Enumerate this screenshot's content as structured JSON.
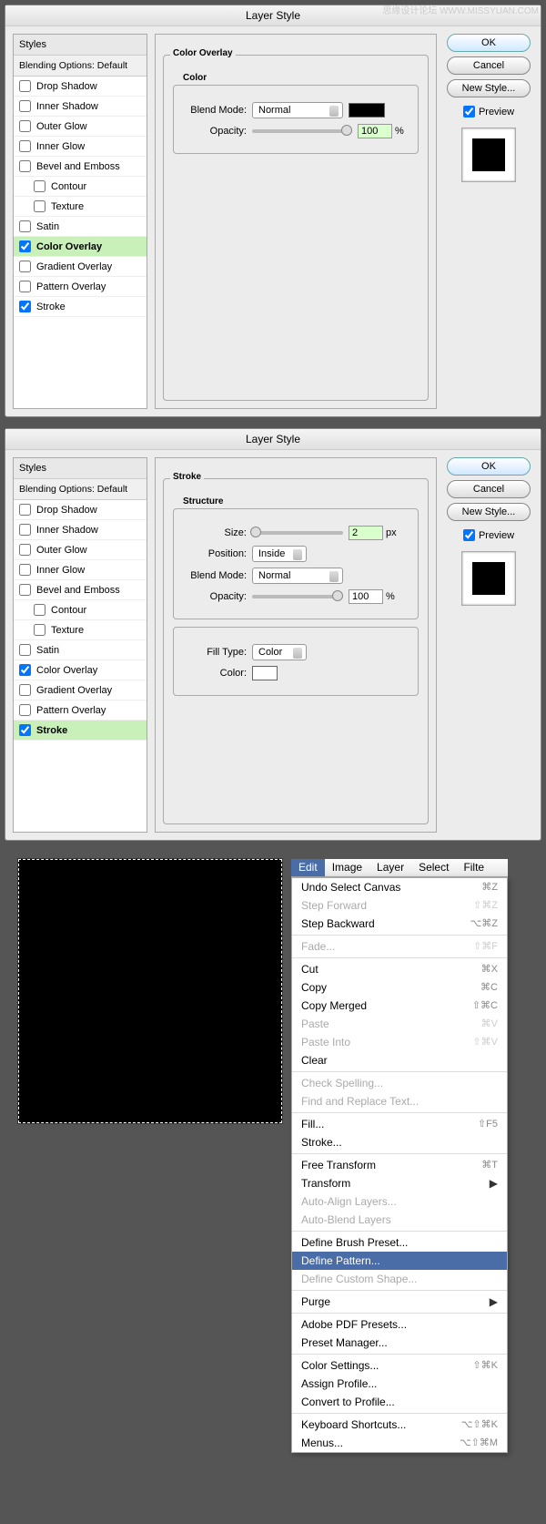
{
  "watermark": "思缘设计论坛  WWW.MISSYUAN.COM",
  "dialog1": {
    "title": "Layer Style",
    "styles_header": "Styles",
    "blending": "Blending Options: Default",
    "items": [
      {
        "label": "Drop Shadow",
        "checked": false
      },
      {
        "label": "Inner Shadow",
        "checked": false
      },
      {
        "label": "Outer Glow",
        "checked": false
      },
      {
        "label": "Inner Glow",
        "checked": false
      },
      {
        "label": "Bevel and Emboss",
        "checked": false
      },
      {
        "label": "Contour",
        "checked": false,
        "indent": true
      },
      {
        "label": "Texture",
        "checked": false,
        "indent": true
      },
      {
        "label": "Satin",
        "checked": false
      },
      {
        "label": "Color Overlay",
        "checked": true,
        "selected": true
      },
      {
        "label": "Gradient Overlay",
        "checked": false
      },
      {
        "label": "Pattern Overlay",
        "checked": false
      },
      {
        "label": "Stroke",
        "checked": true
      }
    ],
    "panel_title": "Color Overlay",
    "group_title": "Color",
    "blend_mode_label": "Blend Mode:",
    "blend_mode_value": "Normal",
    "opacity_label": "Opacity:",
    "opacity_value": "100",
    "opacity_unit": "%"
  },
  "dialog2": {
    "title": "Layer Style",
    "panel_title": "Stroke",
    "structure_title": "Structure",
    "size_label": "Size:",
    "size_value": "2",
    "size_unit": "px",
    "position_label": "Position:",
    "position_value": "Inside",
    "blend_mode_label": "Blend Mode:",
    "blend_mode_value": "Normal",
    "opacity_label": "Opacity:",
    "opacity_value": "100",
    "opacity_unit": "%",
    "filltype_label": "Fill Type:",
    "filltype_value": "Color",
    "color_label": "Color:",
    "selected_item": "Stroke"
  },
  "buttons": {
    "ok": "OK",
    "cancel": "Cancel",
    "new_style": "New Style...",
    "preview": "Preview"
  },
  "menubar": [
    "Edit",
    "Image",
    "Layer",
    "Select",
    "Filte"
  ],
  "menu": [
    {
      "label": "Undo Select Canvas",
      "shortcut": "⌘Z"
    },
    {
      "label": "Step Forward",
      "shortcut": "⇧⌘Z",
      "disabled": true
    },
    {
      "label": "Step Backward",
      "shortcut": "⌥⌘Z"
    },
    {
      "sep": true
    },
    {
      "label": "Fade...",
      "shortcut": "⇧⌘F",
      "disabled": true
    },
    {
      "sep": true
    },
    {
      "label": "Cut",
      "shortcut": "⌘X"
    },
    {
      "label": "Copy",
      "shortcut": "⌘C"
    },
    {
      "label": "Copy Merged",
      "shortcut": "⇧⌘C"
    },
    {
      "label": "Paste",
      "shortcut": "⌘V",
      "disabled": true
    },
    {
      "label": "Paste Into",
      "shortcut": "⇧⌘V",
      "disabled": true
    },
    {
      "label": "Clear"
    },
    {
      "sep": true
    },
    {
      "label": "Check Spelling...",
      "disabled": true
    },
    {
      "label": "Find and Replace Text...",
      "disabled": true
    },
    {
      "sep": true
    },
    {
      "label": "Fill...",
      "shortcut": "⇧F5"
    },
    {
      "label": "Stroke..."
    },
    {
      "sep": true
    },
    {
      "label": "Free Transform",
      "shortcut": "⌘T"
    },
    {
      "label": "Transform",
      "submenu": true
    },
    {
      "label": "Auto-Align Layers...",
      "disabled": true
    },
    {
      "label": "Auto-Blend Layers",
      "disabled": true
    },
    {
      "sep": true
    },
    {
      "label": "Define Brush Preset..."
    },
    {
      "label": "Define Pattern...",
      "highlighted": true
    },
    {
      "label": "Define Custom Shape...",
      "disabled": true
    },
    {
      "sep": true
    },
    {
      "label": "Purge",
      "submenu": true
    },
    {
      "sep": true
    },
    {
      "label": "Adobe PDF Presets..."
    },
    {
      "label": "Preset Manager..."
    },
    {
      "sep": true
    },
    {
      "label": "Color Settings...",
      "shortcut": "⇧⌘K"
    },
    {
      "label": "Assign Profile..."
    },
    {
      "label": "Convert to Profile..."
    },
    {
      "sep": true
    },
    {
      "label": "Keyboard Shortcuts...",
      "shortcut": "⌥⇧⌘K"
    },
    {
      "label": "Menus...",
      "shortcut": "⌥⇧⌘M"
    }
  ]
}
